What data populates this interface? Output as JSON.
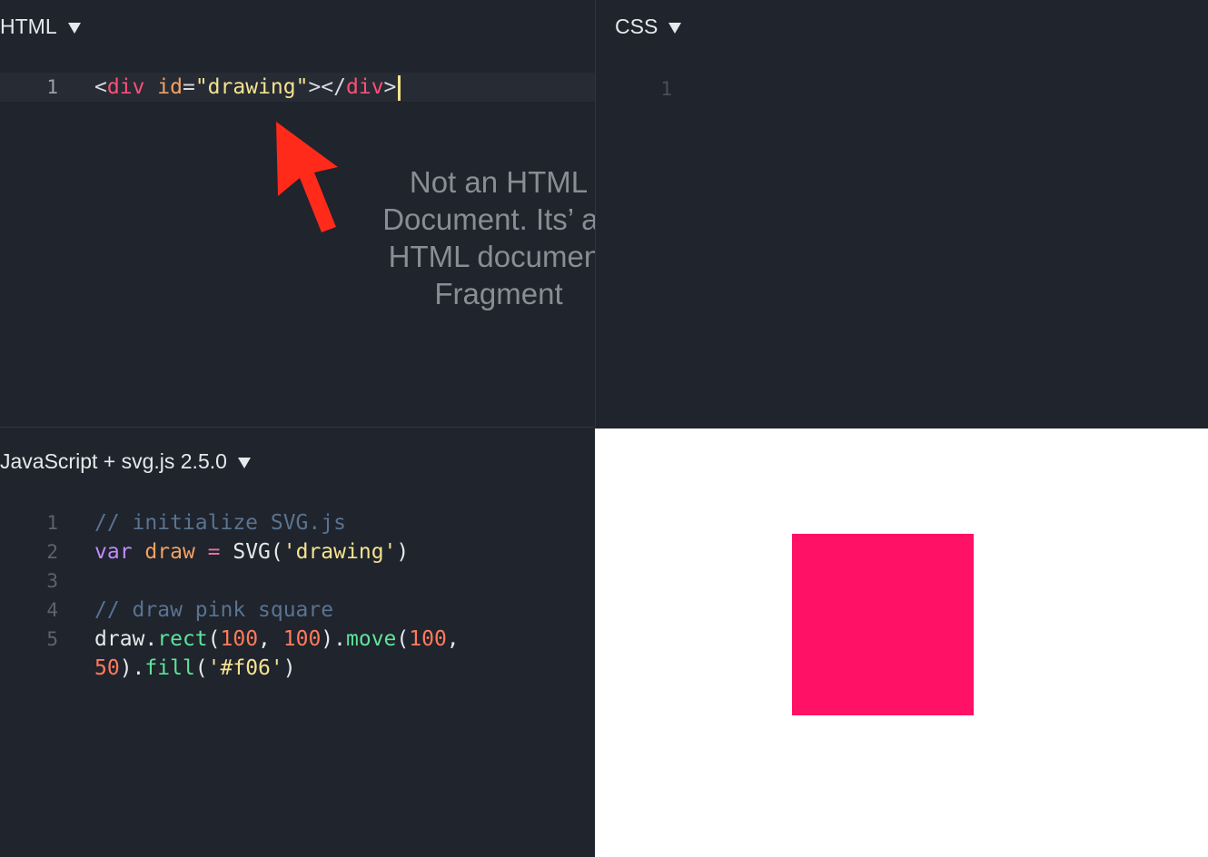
{
  "panes": {
    "html": {
      "label": "HTML",
      "lines": [
        {
          "number": "1",
          "tokens": [
            {
              "t": "<",
              "c": "tok-punc"
            },
            {
              "t": "div",
              "c": "tok-tag"
            },
            {
              "t": " ",
              "c": "tok-plain"
            },
            {
              "t": "id",
              "c": "tok-attr"
            },
            {
              "t": "=",
              "c": "tok-punc"
            },
            {
              "t": "\"drawing\"",
              "c": "tok-str"
            },
            {
              "t": "></",
              "c": "tok-punc"
            },
            {
              "t": "div",
              "c": "tok-tag"
            },
            {
              "t": ">",
              "c": "tok-punc"
            }
          ]
        }
      ]
    },
    "css": {
      "label": "CSS",
      "lines": [
        {
          "number": "1",
          "tokens": []
        }
      ]
    },
    "js": {
      "label": "JavaScript + svg.js 2.5.0",
      "lines": [
        {
          "number": "1",
          "tokens": [
            {
              "t": "// initialize SVG.js",
              "c": "tok-comment"
            }
          ]
        },
        {
          "number": "2",
          "tokens": [
            {
              "t": "var",
              "c": "tok-keyword"
            },
            {
              "t": " ",
              "c": "tok-plain"
            },
            {
              "t": "draw",
              "c": "tok-var"
            },
            {
              "t": " ",
              "c": "tok-plain"
            },
            {
              "t": "=",
              "c": "tok-op"
            },
            {
              "t": " SVG(",
              "c": "tok-plain"
            },
            {
              "t": "'drawing'",
              "c": "tok-str"
            },
            {
              "t": ")",
              "c": "tok-plain"
            }
          ]
        },
        {
          "number": "3",
          "tokens": []
        },
        {
          "number": "4",
          "tokens": [
            {
              "t": "// draw pink square",
              "c": "tok-comment"
            }
          ]
        },
        {
          "number": "5",
          "tokens": [
            {
              "t": "draw.",
              "c": "tok-plain"
            },
            {
              "t": "rect",
              "c": "tok-fn"
            },
            {
              "t": "(",
              "c": "tok-plain"
            },
            {
              "t": "100",
              "c": "tok-num"
            },
            {
              "t": ", ",
              "c": "tok-plain"
            },
            {
              "t": "100",
              "c": "tok-num"
            },
            {
              "t": ").",
              "c": "tok-plain"
            },
            {
              "t": "move",
              "c": "tok-fn"
            },
            {
              "t": "(",
              "c": "tok-plain"
            },
            {
              "t": "100",
              "c": "tok-num"
            },
            {
              "t": ",",
              "c": "tok-plain"
            }
          ]
        },
        {
          "number": "",
          "tokens": [
            {
              "t": "50",
              "c": "tok-num"
            },
            {
              "t": ").",
              "c": "tok-plain"
            },
            {
              "t": "fill",
              "c": "tok-fn"
            },
            {
              "t": "(",
              "c": "tok-plain"
            },
            {
              "t": "'#f06'",
              "c": "tok-str"
            },
            {
              "t": ")",
              "c": "tok-plain"
            }
          ]
        }
      ]
    }
  },
  "annotation": {
    "lines": [
      "Not an HTML",
      "Document. Its’ an",
      "HTML document",
      "Fragment"
    ],
    "arrow_color": "#ff2a1a"
  },
  "output": {
    "square_color": "#ff1166"
  }
}
